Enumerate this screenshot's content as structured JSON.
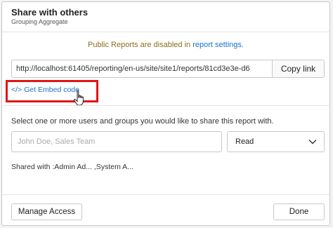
{
  "dialog": {
    "title": "Share with others",
    "subtitle": "Grouping Aggregate",
    "close_icon": "close-icon"
  },
  "notice": {
    "text": "Public Reports are disabled in ",
    "link": "report settings",
    "suffix": "."
  },
  "share_link": {
    "url": "http://localhost:61405/reporting/en-us/site/site1/reports/81cd3e3e-d6",
    "copy_label": "Copy link"
  },
  "embed": {
    "icon": "</>",
    "label": "Get Embed code",
    "highlight_color": "#e01515"
  },
  "users": {
    "instruction": "Select one or more users and groups you would like to share this report with.",
    "placeholder": "John Doe, Sales Team",
    "permission": "Read"
  },
  "shared_with": "Shared with :Admin Ad... ,System A...",
  "footer": {
    "manage_label": "Manage Access",
    "done_label": "Done"
  },
  "colors": {
    "link": "#1a73c8",
    "notice_text": "#8a6d1f"
  }
}
